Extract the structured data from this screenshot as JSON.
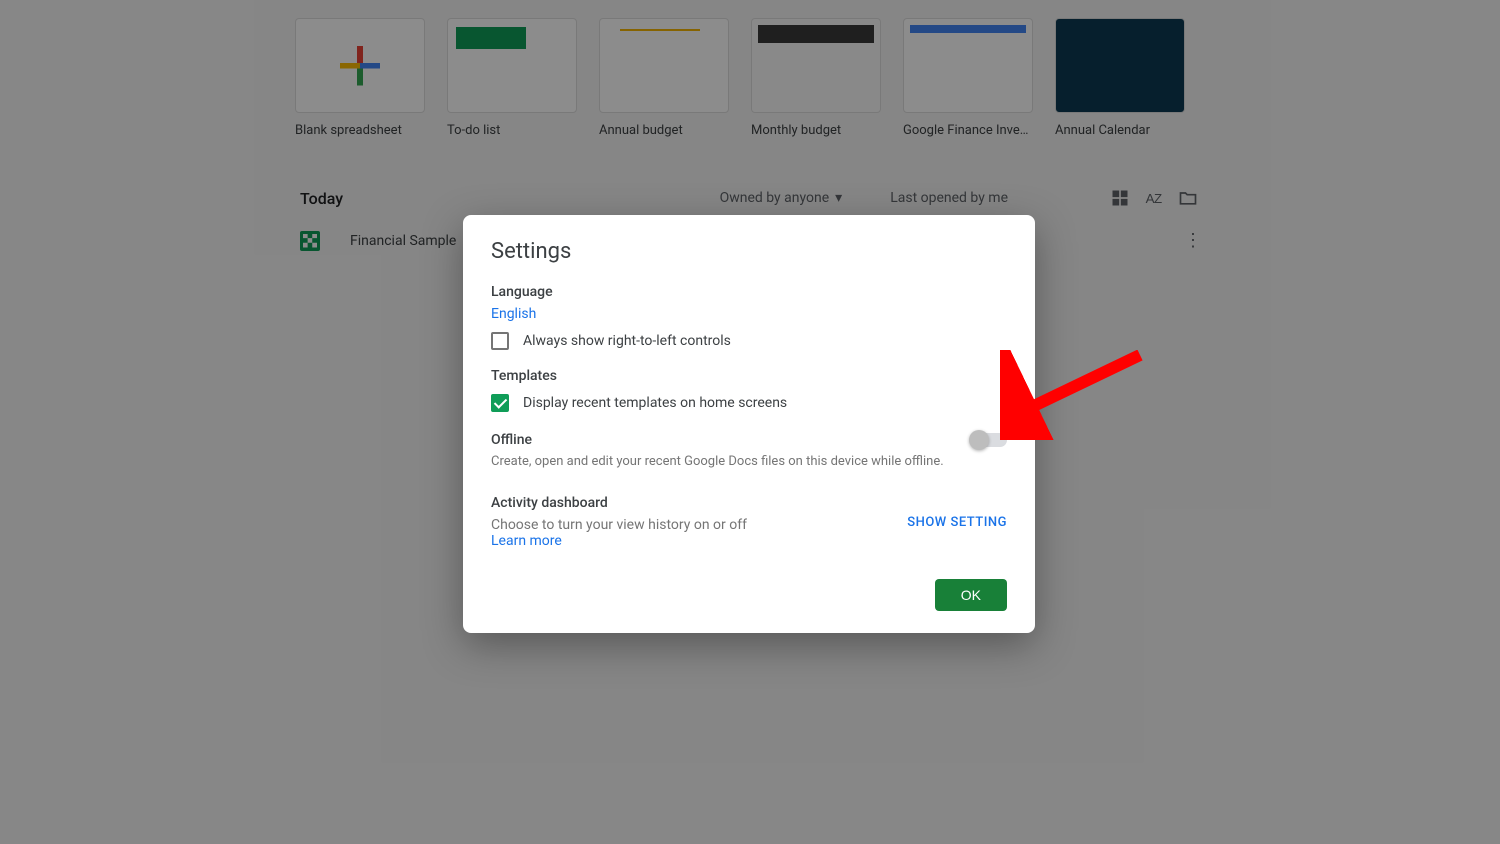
{
  "templates": [
    {
      "label": "Blank spreadsheet"
    },
    {
      "label": "To-do list"
    },
    {
      "label": "Annual budget"
    },
    {
      "label": "Monthly budget"
    },
    {
      "label": "Google Finance Invest…"
    },
    {
      "label": "Annual Calendar"
    }
  ],
  "list": {
    "section": "Today",
    "owned": "Owned by anyone",
    "sort": "Last opened by me",
    "file": "Financial Sample"
  },
  "dialog": {
    "title": "Settings",
    "language": {
      "title": "Language",
      "value": "English",
      "rtl_label": "Always show right-to-left controls"
    },
    "templates_section": {
      "title": "Templates",
      "display_label": "Display recent templates on home screens"
    },
    "offline": {
      "title": "Offline",
      "desc": "Create, open and edit your recent Google Docs files on this device while offline."
    },
    "activity": {
      "title": "Activity dashboard",
      "desc": "Choose to turn your view history on or off",
      "learn": "Learn more",
      "show": "SHOW SETTING"
    },
    "ok": "OK"
  }
}
